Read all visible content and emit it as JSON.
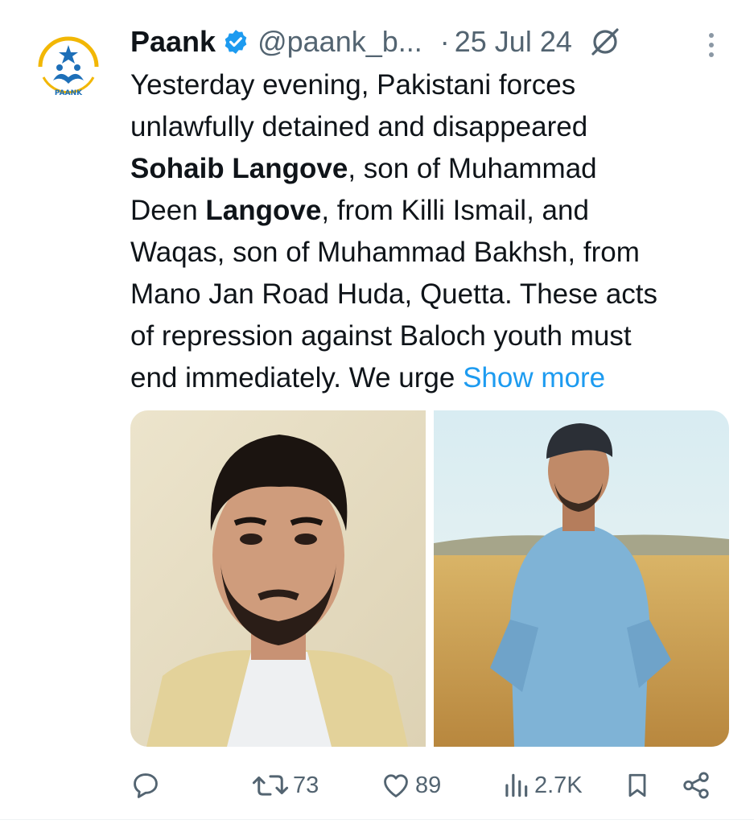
{
  "author": {
    "name": "Paank",
    "handle": "@paank_b...",
    "separator": "·",
    "date": "25 Jul 24",
    "avatar_text": "PAANK",
    "verified_color": "#1d9bf0"
  },
  "tweet": {
    "segments": [
      [
        "Yesterday evening, Pakistani forces"
      ],
      [
        "unlawfully detained and disappeared"
      ],
      [
        {
          "bold": "Sohaib Langove"
        },
        ", son of Muhammad"
      ],
      [
        "Deen ",
        {
          "bold": "Langove"
        },
        ", from Killi Ismail, and"
      ],
      [
        "Waqas, son of Muhammad Bakhsh, from"
      ],
      [
        "Mano Jan Road Huda, Quetta. These acts"
      ],
      [
        "of repression against Baloch youth must"
      ],
      [
        "end immediately. We urge ",
        {
          "link": "Show more"
        }
      ]
    ]
  },
  "actions": {
    "reply_icon": "reply-icon",
    "retweets": "73",
    "likes": "89",
    "views": "2.7K",
    "bookmark_icon": "bookmark-icon",
    "share_icon": "share-icon"
  },
  "colors": {
    "text": "#0f1419",
    "secondary": "#536471",
    "link": "#1d9bf0"
  }
}
